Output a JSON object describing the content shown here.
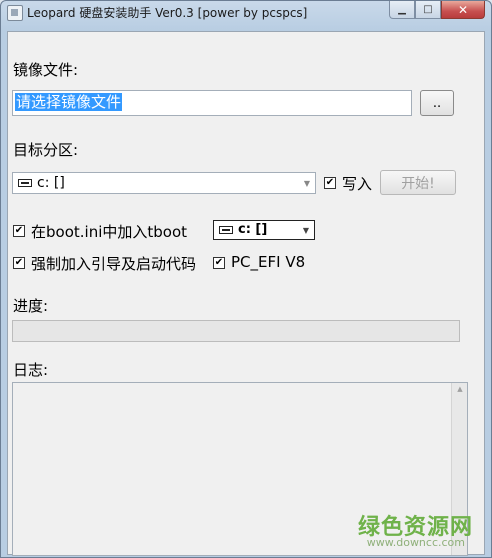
{
  "window": {
    "title": "Leopard 硬盘安装助手 Ver0.3 [power by pcspcs]",
    "controls": {
      "minimize": "▁",
      "maximize": "□",
      "close": "✕"
    }
  },
  "image_file": {
    "label": "镜像文件:",
    "value": "请选择镜像文件",
    "browse_label": ".."
  },
  "target_partition": {
    "label": "目标分区:",
    "selected": "c: []",
    "write_label": "写入",
    "write_checked": true,
    "start_label": "开始!"
  },
  "boot_options": {
    "add_tboot_label": "在boot.ini中加入tboot",
    "add_tboot_checked": true,
    "boot_drive_selected": "c: []",
    "force_boot_label": "强制加入引导及启动代码",
    "force_boot_checked": true,
    "pc_efi_label": "PC_EFI V8",
    "pc_efi_checked": true
  },
  "progress": {
    "label": "进度:",
    "value": 0
  },
  "log": {
    "label": "日志:"
  },
  "watermark": {
    "brand": "绿色资源网",
    "url": "www.downcc.com"
  },
  "icons": [
    "app-icon",
    "drive-icon",
    "checkmark-icon",
    "dropdown-arrow-icon",
    "scroll-up-icon"
  ],
  "colors": {
    "selection": "#3399ff",
    "close_button": "#c75050",
    "watermark": "#6fb24a"
  }
}
